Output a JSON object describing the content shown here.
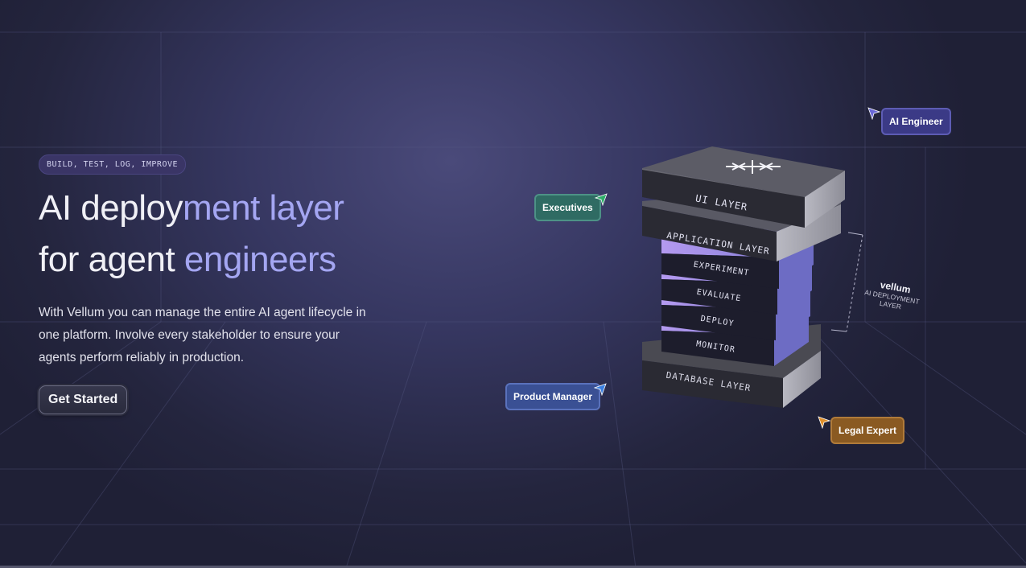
{
  "hero": {
    "eyebrow": "BUILD, TEST, LOG, IMPROVE",
    "headline_line1_a": "AI deploy",
    "headline_line1_b": "ment layer",
    "headline_line2_a": "for agent ",
    "headline_line2_b": "engineers",
    "description": "With Vellum you can manage the entire AI agent lifecycle in one platform. Involve every stakeholder to ensure your agents perform reliably in production.",
    "cta_label": "Get Started"
  },
  "stack": {
    "layers": [
      "UI LAYER",
      "APPLICATION LAYER",
      "EXPERIMENT",
      "EVALUATE",
      "DEPLOY",
      "MONITOR",
      "DATABASE LAYER"
    ],
    "brand": "vellum",
    "bracket_label_line1": "AI DEPLOYMENT",
    "bracket_label_line2": "LAYER"
  },
  "roles": {
    "ai_engineer": "AI Engineer",
    "executives": "Executives",
    "product_manager": "Product Manager",
    "legal_expert": "Legal Expert"
  },
  "colors": {
    "accent": "#a4a6f2",
    "ai_engineer": "#3b3a86",
    "executives": "#2f6b63",
    "product_manager": "#3a5094",
    "legal_expert": "#8a5a22"
  },
  "icons": [
    "logo-icon",
    "cursor-arrow-icon"
  ]
}
